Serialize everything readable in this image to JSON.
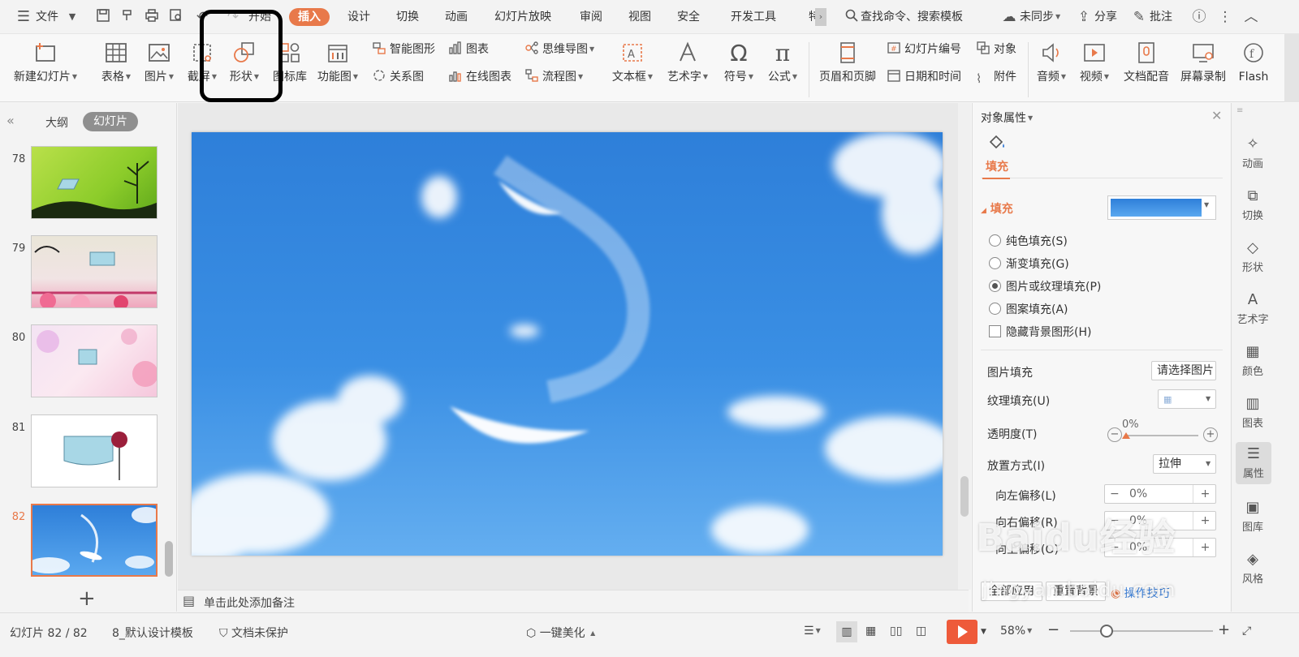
{
  "menubar": {
    "file_label": "文件",
    "tabs": [
      "开始",
      "插入",
      "设计",
      "切换",
      "动画",
      "幻灯片放映",
      "审阅",
      "视图",
      "安全",
      "开发工具",
      "特"
    ],
    "active_tab": "插入",
    "search_placeholder": "查找命令、搜索模板",
    "sync": "未同步",
    "share": "分享",
    "comment": "批注"
  },
  "ribbon": {
    "new_slide": "新建幻灯片",
    "table": "表格",
    "picture": "图片",
    "screenshot": "截屏",
    "shape": "形状",
    "icon_lib": "图标库",
    "func_chart": "功能图",
    "smart_art": "智能图形",
    "chart": "图表",
    "mindmap": "思维导图",
    "relation": "关系图",
    "online_chart": "在线图表",
    "flowchart": "流程图",
    "textbox": "文本框",
    "wordart": "艺术字",
    "symbol": "符号",
    "formula": "公式",
    "header_footer": "页眉和页脚",
    "slide_number": "幻灯片编号",
    "object": "对象",
    "datetime": "日期和时间",
    "attachment": "附件",
    "audio": "音频",
    "video": "视频",
    "doc_voice": "文档配音",
    "screen_rec": "屏幕录制",
    "flash": "Flash"
  },
  "leftpanel": {
    "tab_outline": "大纲",
    "tab_slides": "幻灯片",
    "slides": [
      {
        "num": "78"
      },
      {
        "num": "79"
      },
      {
        "num": "80"
      },
      {
        "num": "81"
      },
      {
        "num": "82"
      }
    ],
    "selected": "82"
  },
  "notes": {
    "placeholder": "单击此处添加备注"
  },
  "rightpanel": {
    "title": "对象属性",
    "tab_fill": "填充",
    "section_fill": "填充",
    "options": [
      "纯色填充(S)",
      "渐变填充(G)",
      "图片或纹理填充(P)",
      "图案填充(A)"
    ],
    "selected_option": "图片或纹理填充(P)",
    "hide_bg": "隐藏背景图形(H)",
    "pic_fill_label": "图片填充",
    "pic_fill_btn": "请选择图片",
    "texture_label": "纹理填充(U)",
    "transparency_label": "透明度(T)",
    "transparency_value": "0%",
    "placement_label": "放置方式(I)",
    "placement_value": "拉伸",
    "offset_left_label": "向左偏移(L)",
    "offset_left": "0%",
    "offset_right_label": "向右偏移(R)",
    "offset_right": "0%",
    "offset_up_label": "向上偏移(O)",
    "offset_up": "0%",
    "apply_all": "全部应用",
    "reset_bg": "重置背景",
    "tips": "操作技巧"
  },
  "sidebar": {
    "items": [
      "动画",
      "切换",
      "形状",
      "艺术字",
      "颜色",
      "图表",
      "属性",
      "图库",
      "风格"
    ],
    "active": "属性"
  },
  "statusbar": {
    "slide_pos": "幻灯片 82 / 82",
    "template": "8_默认设计模板",
    "protect": "文档未保护",
    "beautify": "一键美化",
    "zoom": "58%"
  },
  "watermark": {
    "brand": "Baidu经验",
    "url": "jingyan.baidu.com"
  },
  "colors": {
    "accent": "#e8794a",
    "slide_sky": "#3a8fe4"
  }
}
